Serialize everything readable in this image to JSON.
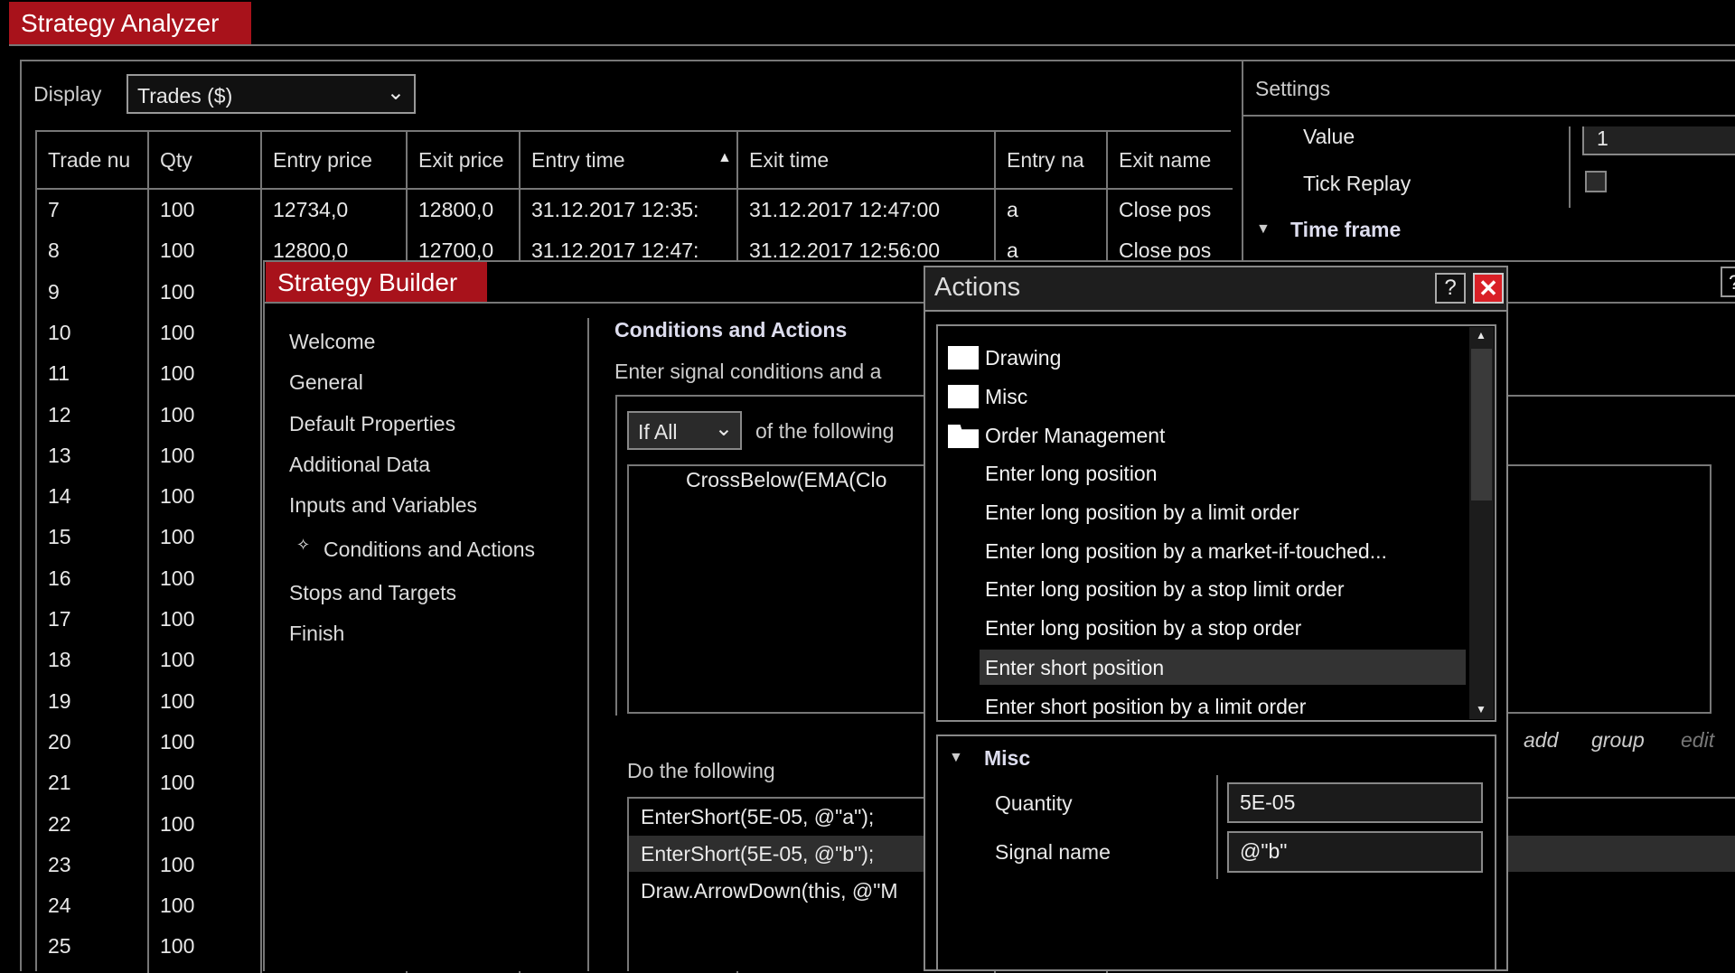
{
  "analyzer": {
    "title": "Strategy Analyzer",
    "display_label": "Display",
    "display_value": "Trades ($)",
    "columns": [
      "Trade nu",
      "Qty",
      "Entry price",
      "Exit price",
      "Entry time",
      "Exit time",
      "Entry na",
      "Exit name"
    ],
    "rows": [
      [
        "7",
        "100",
        "12734,0",
        "12800,0",
        "31.12.2017 12:35:",
        "31.12.2017 12:47:00",
        "a",
        "Close pos"
      ],
      [
        "8",
        "100",
        "12800,0",
        "12700,0",
        "31.12.2017 12:47:",
        "31.12.2017 12:56:00",
        "a",
        "Close pos"
      ],
      [
        "9",
        "100"
      ],
      [
        "10",
        "100"
      ],
      [
        "11",
        "100"
      ],
      [
        "12",
        "100"
      ],
      [
        "13",
        "100"
      ],
      [
        "14",
        "100"
      ],
      [
        "15",
        "100"
      ],
      [
        "16",
        "100"
      ],
      [
        "17",
        "100"
      ],
      [
        "18",
        "100"
      ],
      [
        "19",
        "100"
      ],
      [
        "20",
        "100"
      ],
      [
        "21",
        "100"
      ],
      [
        "22",
        "100"
      ],
      [
        "23",
        "100"
      ],
      [
        "24",
        "100"
      ],
      [
        "25",
        "100"
      ]
    ]
  },
  "settings": {
    "title": "Settings",
    "value_label": "Value",
    "value": "1",
    "tick_replay_label": "Tick Replay",
    "time_frame_label": "Time frame"
  },
  "builder": {
    "title": "Strategy Builder",
    "nav": [
      "Welcome",
      "General",
      "Default Properties",
      "Additional Data",
      "Inputs and Variables",
      "Conditions and Actions",
      "Stops and Targets",
      "Finish"
    ],
    "heading": "Conditions and Actions",
    "subtitle": "Enter signal conditions and a",
    "if_value": "If All",
    "of_following": "of the following",
    "condition": "CrossBelow(EMA(Clo",
    "do_following": "Do the following",
    "actions": [
      "EnterShort(5E-05, @\"a\");",
      "EnterShort(5E-05, @\"b\");",
      "Draw.ArrowDown(this, @\"M"
    ],
    "add": "add",
    "group": "group",
    "edit": "edit",
    "help": "?"
  },
  "actions_dialog": {
    "title": "Actions",
    "help": "?",
    "folders": [
      "Drawing",
      "Misc",
      "Order Management"
    ],
    "items": [
      "Enter long position",
      "Enter long position by a limit order",
      "Enter long position by a market-if-touched...",
      "Enter long position by a stop limit order",
      "Enter long position by a stop order",
      "Enter short position",
      "Enter short position by a limit order"
    ],
    "selected_index": 5,
    "props": {
      "section": "Misc",
      "quantity_label": "Quantity",
      "quantity": "5E-05",
      "signal_label": "Signal name",
      "signal": "@\"b\""
    }
  },
  "colors": {
    "accent": "#a8121b",
    "close": "#d92027"
  }
}
